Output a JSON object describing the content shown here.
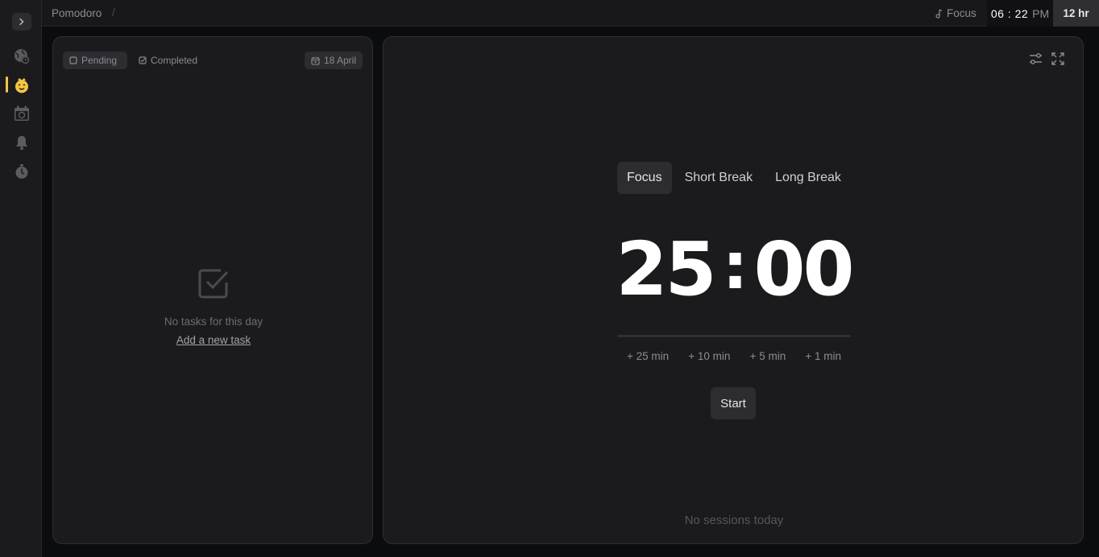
{
  "breadcrumb": {
    "title": "Pomodoro",
    "separator": "/"
  },
  "header": {
    "mode_label": "Focus",
    "clock": {
      "time": "06 : 22",
      "ampm": "PM"
    },
    "format_label": "12 hr"
  },
  "sidebar": {
    "items": [
      {
        "icon": "globe-clock-icon",
        "active": false
      },
      {
        "icon": "pomodoro-face-icon",
        "active": true
      },
      {
        "icon": "calendar-check-icon",
        "active": false
      },
      {
        "icon": "bell-icon",
        "active": false
      },
      {
        "icon": "stopwatch-icon",
        "active": false
      }
    ],
    "accent_color": "#f5c542"
  },
  "tasks": {
    "filters": {
      "pending": "Pending",
      "completed": "Completed"
    },
    "date_label": "18 April",
    "empty_text": "No tasks for this day",
    "add_link": "Add a new task"
  },
  "timer": {
    "tabs": [
      "Focus",
      "Short Break",
      "Long Break"
    ],
    "active_tab": "Focus",
    "minutes": "25",
    "colon": ":",
    "seconds": "00",
    "progress": 0,
    "add_options": [
      "+ 25 min",
      "+ 10 min",
      "+ 5 min",
      "+ 1 min"
    ],
    "start_label": "Start",
    "sessions_text": "No sessions today"
  }
}
